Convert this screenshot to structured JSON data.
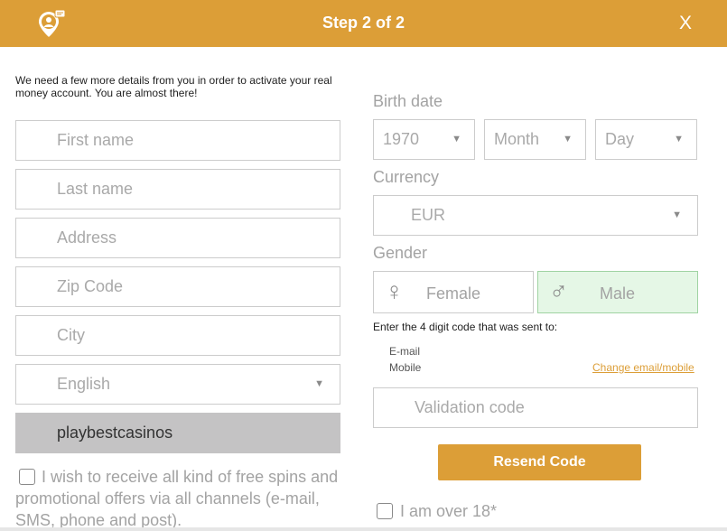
{
  "header": {
    "title": "Step 2 of 2",
    "close_label": "X",
    "logo_icon": "location-user-chat-icon",
    "brand_color": "#dc9e37"
  },
  "intro_text": "We need a few more details from you in order to activate your real money account. You are almost there!",
  "left_form": {
    "first_name_placeholder": "First name",
    "last_name_placeholder": "Last name",
    "address_placeholder": "Address",
    "zip_placeholder": "Zip Code",
    "city_placeholder": "City",
    "language_value": "English",
    "affiliate_value": "playbestcasinos",
    "promo_checkbox_label": "I wish to receive all kind of free spins and promotional offers via all channels (e-mail, SMS, phone and post).",
    "promo_checked": false
  },
  "right_form": {
    "birth_label": "Birth date",
    "year_value": "1970",
    "month_value": "Month",
    "day_value": "Day",
    "currency_label": "Currency",
    "currency_value": "EUR",
    "gender_label": "Gender",
    "female_label": "Female",
    "male_label": "Male",
    "selected_gender": "Male",
    "selected_color": "#e5f7e6",
    "code_instructions": "Enter the 4 digit code that was sent to:",
    "email_label": "E-mail",
    "mobile_label": "Mobile",
    "change_link": "Change email/mobile",
    "validation_placeholder": "Validation code",
    "resend_button": "Resend Code",
    "age_checkbox_label": "I am over 18*",
    "age_checked": false
  },
  "icons": {
    "dropdown": "▼",
    "female": "♀",
    "male": "♂"
  }
}
